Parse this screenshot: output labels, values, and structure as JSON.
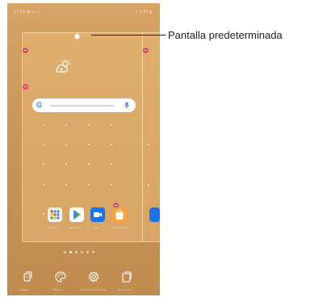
{
  "status_bar": {
    "left": "11:02 ◉ ◎ ☼",
    "right": "✦ 2:55 ▮"
  },
  "home_screen": {
    "weather_widget_icon": "weather-add-icon",
    "search_widget": {
      "logo": "G",
      "mic_icon": "mic-icon",
      "placeholder": ""
    },
    "apps": [
      {
        "name": "Google",
        "icon": "google-folder-icon",
        "color": "#f2f2f2"
      },
      {
        "name": "Play Store",
        "icon": "play-store-icon",
        "color": "#ffffff"
      },
      {
        "name": "Duo",
        "icon": "duo-icon",
        "color": "#1a73e8"
      },
      {
        "name": "Galaxy Store",
        "icon": "galaxy-store-icon",
        "color": "#f7a23b"
      }
    ]
  },
  "toolbar": {
    "items": [
      {
        "label": "Widgets",
        "icon": "widgets-icon"
      },
      {
        "label": "Themes",
        "icon": "palette-icon"
      },
      {
        "label": "Home screen settings",
        "icon": "gear-icon"
      },
      {
        "label": "Wallpapers",
        "icon": "wallpaper-icon"
      }
    ]
  },
  "callout": {
    "label": "Pantalla predeterminada"
  },
  "colors": {
    "wallpaper_top": "#d7a466",
    "wallpaper_bottom": "#bf8b4f",
    "remove_badge": "#e8465e",
    "callout_line": "#222222"
  }
}
